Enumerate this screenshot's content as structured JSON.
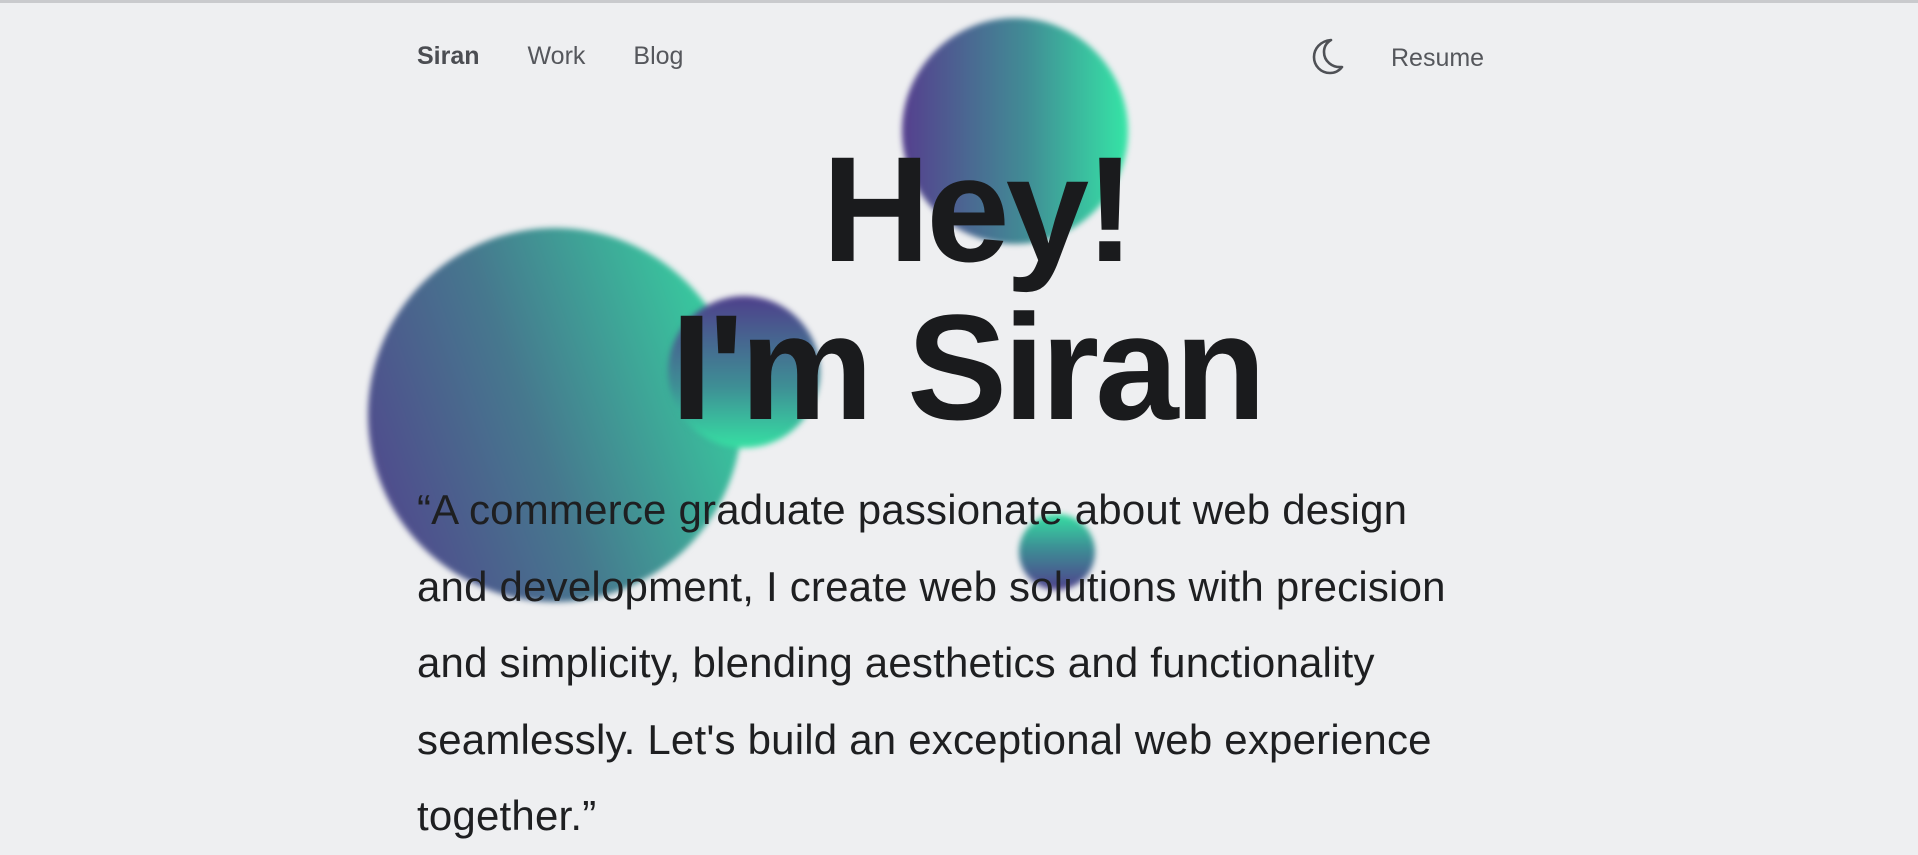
{
  "nav": {
    "brand": "Siran",
    "links": [
      {
        "label": "Work"
      },
      {
        "label": "Blog"
      }
    ],
    "theme_toggle_icon": "moon-icon",
    "resume_label": "Resume"
  },
  "hero": {
    "title_line_1": "Hey!",
    "title_line_2": "I'm Siran",
    "intro": "“A commerce graduate passionate about web design and development, I create web solutions with precision and simplicity, blending aesthetics and functionality seamlessly. Let's build an exceptional web experience together.”"
  },
  "colors": {
    "background": "#eeeff1",
    "text": "#1b1c1e",
    "blob_purple": "#523f8c",
    "blob_green": "#34e0a3"
  }
}
